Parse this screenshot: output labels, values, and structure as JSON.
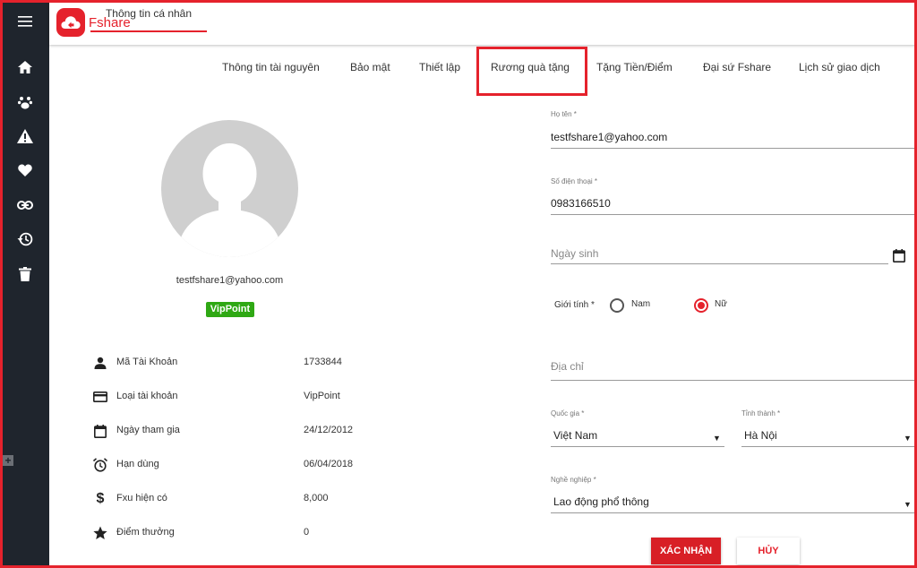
{
  "brand": {
    "name": "Fshare",
    "color": "#e5222c"
  },
  "sidebar": {
    "icons": [
      "menu-icon",
      "home-icon",
      "paw-icon",
      "warning-icon",
      "heart-icon",
      "link-icon",
      "history-icon",
      "trash-icon"
    ],
    "expand_label": "+"
  },
  "tabs": [
    {
      "label": "Thông tin cá nhân",
      "active": true
    },
    {
      "label": "Thông tin tài nguyên"
    },
    {
      "label": "Bảo mật"
    },
    {
      "label": "Thiết lập"
    },
    {
      "label": "Rương quà tặng",
      "highlighted": true
    },
    {
      "label": "Tặng Tiền/Điểm"
    },
    {
      "label": "Đại sứ Fshare"
    },
    {
      "label": "Lịch sử giao dịch"
    }
  ],
  "profile": {
    "email": "testfshare1@yahoo.com",
    "badge": "VipPoint",
    "info": [
      {
        "icon": "person-icon",
        "label": "Mã Tài Khoản",
        "value": "1733844"
      },
      {
        "icon": "card-icon",
        "label": "Loại tài khoản",
        "value": "VipPoint"
      },
      {
        "icon": "calendar-icon",
        "label": "Ngày tham gia",
        "value": "24/12/2012"
      },
      {
        "icon": "alarm-icon",
        "label": "Hạn dùng",
        "value": "06/04/2018"
      },
      {
        "icon": "dollar-icon",
        "label": "Fxu hiện có",
        "value": "8,000"
      },
      {
        "icon": "star-icon",
        "label": "Điểm thưởng",
        "value": "0"
      }
    ]
  },
  "form": {
    "name_label": "Họ tên *",
    "name_value": "testfshare1@yahoo.com",
    "phone_label": "Số điện thoại *",
    "phone_value": "0983166510",
    "birthday_placeholder": "Ngày sinh",
    "gender_label": "Giới tính *",
    "gender_options": [
      "Nam",
      "Nữ"
    ],
    "gender_selected": "Nữ",
    "address_placeholder": "Địa chỉ",
    "country_label": "Quốc gia *",
    "country_value": "Việt Nam",
    "city_label": "Tỉnh thành *",
    "city_value": "Hà Nội",
    "job_label": "Nghề nghiệp *",
    "job_value": "Lao động phổ thông",
    "caret": "▼",
    "confirm_label": "XÁC NHẬN",
    "cancel_label": "HỦY"
  }
}
